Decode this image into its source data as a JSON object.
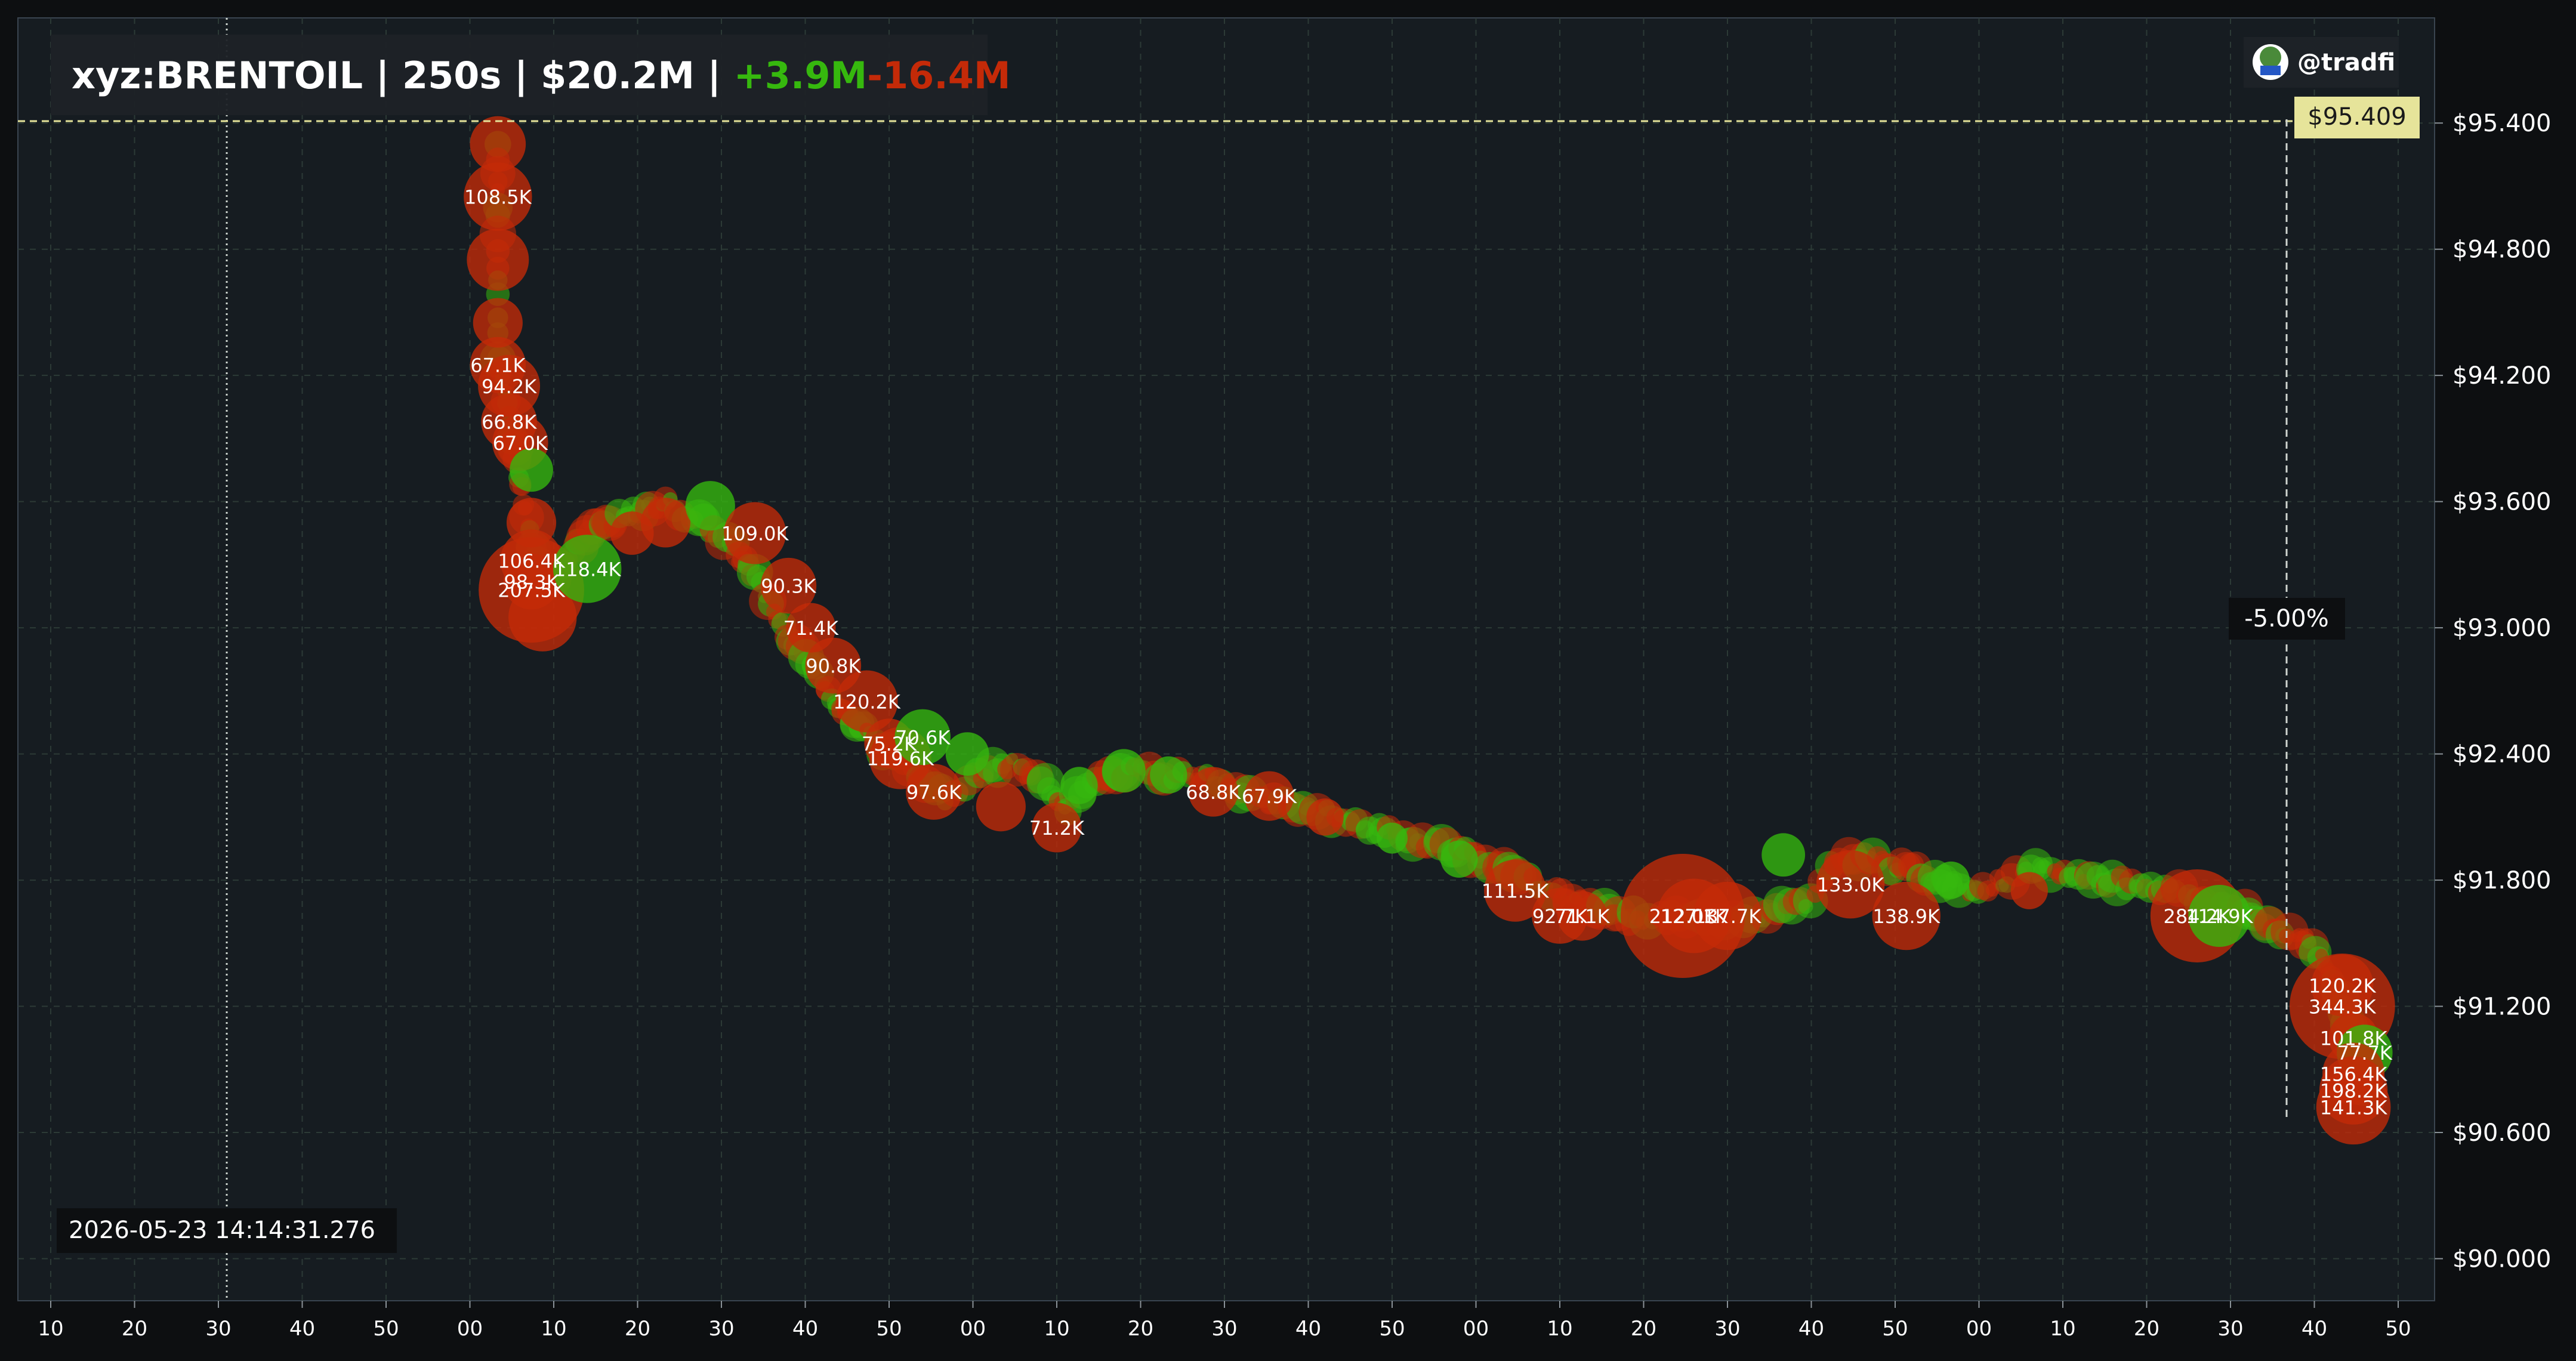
{
  "header": {
    "symbol": "xyz:BRENTOIL",
    "sep1": " | ",
    "window": "250s",
    "sep2": " | ",
    "volume": "$20.2M",
    "sep3": " | ",
    "buy": "+3.9M",
    "sell": "-16.4M"
  },
  "badge": {
    "handle": "@tradfi"
  },
  "timestamp": "2026-05-23 14:14:31.276",
  "current_price_label": "$95.409",
  "pct_change_label": "-5.00%",
  "colors": {
    "background": "#161c21",
    "buy": "#36b80e",
    "sell": "#c42a08",
    "price_line": "#e6e49a",
    "price_tag_bg": "#e6e49a",
    "grid": "#2c3a36"
  },
  "chart_data": {
    "type": "scatter",
    "title": "",
    "xlabel": "",
    "ylabel": "",
    "ylim": [
      89.8,
      95.9
    ],
    "x_tick_labels": [
      "10",
      "20",
      "30",
      "40",
      "50",
      "00",
      "10",
      "20",
      "30",
      "40",
      "50",
      "00",
      "10",
      "20",
      "30",
      "40",
      "50",
      "00",
      "10",
      "20",
      "30",
      "40",
      "50",
      "00",
      "10",
      "20",
      "30",
      "40",
      "50"
    ],
    "y_ticks": [
      90.0,
      90.6,
      91.2,
      91.8,
      92.4,
      93.0,
      93.6,
      94.2,
      94.8,
      95.4
    ],
    "y_tick_labels": [
      "$90.000",
      "$90.600",
      "$91.200",
      "$91.800",
      "$92.400",
      "$93.000",
      "$93.600",
      "$94.200",
      "$94.800",
      "$95.400"
    ],
    "current_price": 95.409,
    "grid": true,
    "series_colors": {
      "buy": "#36b80e",
      "sell": "#c42a08"
    },
    "path": [
      [
        40,
        95.3
      ],
      [
        40,
        94.9
      ],
      [
        40,
        94.3
      ],
      [
        41,
        94.0
      ],
      [
        42,
        93.7
      ],
      [
        43,
        93.4
      ],
      [
        44,
        93.2
      ],
      [
        46,
        93.3
      ],
      [
        48,
        93.45
      ],
      [
        50,
        93.5
      ],
      [
        53,
        93.55
      ],
      [
        55,
        93.6
      ],
      [
        58,
        93.5
      ],
      [
        61,
        93.4
      ],
      [
        63,
        93.25
      ],
      [
        65,
        93.05
      ],
      [
        67,
        92.9
      ],
      [
        69,
        92.75
      ],
      [
        71,
        92.6
      ],
      [
        73,
        92.5
      ],
      [
        75,
        92.4
      ],
      [
        78,
        92.3
      ],
      [
        80,
        92.2
      ],
      [
        83,
        92.3
      ],
      [
        86,
        92.35
      ],
      [
        89,
        92.25
      ],
      [
        91,
        92.15
      ],
      [
        94,
        92.28
      ],
      [
        97,
        92.32
      ],
      [
        100,
        92.3
      ],
      [
        103,
        92.3
      ],
      [
        106,
        92.22
      ],
      [
        109,
        92.18
      ],
      [
        112,
        92.15
      ],
      [
        115,
        92.1
      ],
      [
        118,
        92.05
      ],
      [
        121,
        92.0
      ],
      [
        124,
        91.98
      ],
      [
        127,
        91.92
      ],
      [
        130,
        91.85
      ],
      [
        133,
        91.78
      ],
      [
        136,
        91.7
      ],
      [
        139,
        91.65
      ],
      [
        142,
        91.62
      ],
      [
        145,
        91.62
      ],
      [
        148,
        91.62
      ],
      [
        151,
        91.62
      ],
      [
        154,
        91.65
      ],
      [
        157,
        91.7
      ],
      [
        160,
        91.9
      ],
      [
        163,
        91.9
      ],
      [
        166,
        91.85
      ],
      [
        169,
        91.8
      ],
      [
        172,
        91.75
      ],
      [
        175,
        91.8
      ],
      [
        178,
        91.85
      ],
      [
        181,
        91.82
      ],
      [
        184,
        91.8
      ],
      [
        187,
        91.78
      ],
      [
        190,
        91.75
      ],
      [
        193,
        91.7
      ],
      [
        196,
        91.65
      ],
      [
        198,
        91.6
      ],
      [
        200,
        91.55
      ],
      [
        202,
        91.5
      ],
      [
        204,
        91.35
      ],
      [
        205,
        91.2
      ],
      [
        206,
        91.0
      ],
      [
        207,
        90.8
      ]
    ],
    "points": [
      {
        "x": 40,
        "y": 95.3,
        "size": 18,
        "side": "sell"
      },
      {
        "x": 40,
        "y": 95.05,
        "size": 22,
        "side": "sell",
        "label": "108.5K"
      },
      {
        "x": 40,
        "y": 94.75,
        "size": 20,
        "side": "sell"
      },
      {
        "x": 40,
        "y": 94.45,
        "size": 16,
        "side": "sell"
      },
      {
        "x": 40,
        "y": 94.25,
        "size": 18,
        "side": "sell",
        "label": "67.1K"
      },
      {
        "x": 41,
        "y": 94.15,
        "size": 20,
        "side": "sell",
        "label": "94.2K"
      },
      {
        "x": 41,
        "y": 93.98,
        "size": 18,
        "side": "sell",
        "label": "66.8K"
      },
      {
        "x": 42,
        "y": 93.88,
        "size": 18,
        "side": "sell",
        "label": "67.0K"
      },
      {
        "x": 43,
        "y": 93.75,
        "size": 14,
        "side": "buy"
      },
      {
        "x": 43,
        "y": 93.5,
        "size": 16,
        "side": "sell"
      },
      {
        "x": 43,
        "y": 93.32,
        "size": 20,
        "side": "sell",
        "label": "106.4K"
      },
      {
        "x": 43,
        "y": 93.22,
        "size": 18,
        "side": "sell",
        "label": "98.3K"
      },
      {
        "x": 43,
        "y": 93.18,
        "size": 34,
        "side": "sell",
        "label": "207.5K"
      },
      {
        "x": 44,
        "y": 93.05,
        "size": 22,
        "side": "sell"
      },
      {
        "x": 48,
        "y": 93.28,
        "size": 22,
        "side": "buy",
        "label": "118.4K"
      },
      {
        "x": 52,
        "y": 93.45,
        "size": 14,
        "side": "sell"
      },
      {
        "x": 55,
        "y": 93.5,
        "size": 16,
        "side": "sell"
      },
      {
        "x": 59,
        "y": 93.58,
        "size": 16,
        "side": "buy"
      },
      {
        "x": 63,
        "y": 93.45,
        "size": 20,
        "side": "sell",
        "label": "109.0K"
      },
      {
        "x": 66,
        "y": 93.2,
        "size": 18,
        "side": "sell",
        "label": "90.3K"
      },
      {
        "x": 68,
        "y": 93.0,
        "size": 16,
        "side": "sell",
        "label": "71.4K"
      },
      {
        "x": 70,
        "y": 92.82,
        "size": 18,
        "side": "sell",
        "label": "90.8K"
      },
      {
        "x": 73,
        "y": 92.65,
        "size": 20,
        "side": "sell",
        "label": "120.2K"
      },
      {
        "x": 75,
        "y": 92.45,
        "size": 16,
        "side": "sell",
        "label": "75.2K"
      },
      {
        "x": 76,
        "y": 92.38,
        "size": 20,
        "side": "sell",
        "label": "119.6K"
      },
      {
        "x": 78,
        "y": 92.48,
        "size": 18,
        "side": "buy",
        "label": "70.6K"
      },
      {
        "x": 79,
        "y": 92.22,
        "size": 18,
        "side": "sell",
        "label": "97.6K"
      },
      {
        "x": 82,
        "y": 92.4,
        "size": 14,
        "side": "buy"
      },
      {
        "x": 85,
        "y": 92.15,
        "size": 16,
        "side": "sell"
      },
      {
        "x": 90,
        "y": 92.05,
        "size": 16,
        "side": "sell",
        "label": "71.2K"
      },
      {
        "x": 92,
        "y": 92.25,
        "size": 12,
        "side": "buy"
      },
      {
        "x": 96,
        "y": 92.32,
        "size": 14,
        "side": "buy"
      },
      {
        "x": 100,
        "y": 92.3,
        "size": 12,
        "side": "buy"
      },
      {
        "x": 104,
        "y": 92.22,
        "size": 16,
        "side": "sell",
        "label": "68.8K"
      },
      {
        "x": 109,
        "y": 92.2,
        "size": 16,
        "side": "sell",
        "label": "67.9K"
      },
      {
        "x": 114,
        "y": 92.1,
        "size": 12,
        "side": "sell"
      },
      {
        "x": 120,
        "y": 92.0,
        "size": 10,
        "side": "buy"
      },
      {
        "x": 126,
        "y": 91.9,
        "size": 12,
        "side": "buy"
      },
      {
        "x": 131,
        "y": 91.75,
        "size": 20,
        "side": "sell",
        "label": "111.5K"
      },
      {
        "x": 135,
        "y": 91.63,
        "size": 18,
        "side": "sell",
        "label": "92.7K"
      },
      {
        "x": 137,
        "y": 91.63,
        "size": 16,
        "side": "sell",
        "label": "71.1K"
      },
      {
        "x": 146,
        "y": 91.63,
        "size": 40,
        "side": "sell",
        "label": "212.0K"
      },
      {
        "x": 147,
        "y": 91.63,
        "size": 24,
        "side": "sell",
        "label": "127.1K"
      },
      {
        "x": 150,
        "y": 91.63,
        "size": 22,
        "side": "sell",
        "label": "137.7K"
      },
      {
        "x": 155,
        "y": 91.92,
        "size": 14,
        "side": "buy"
      },
      {
        "x": 161,
        "y": 91.78,
        "size": 22,
        "side": "sell",
        "label": "133.0K"
      },
      {
        "x": 166,
        "y": 91.63,
        "size": 22,
        "side": "sell",
        "label": "138.9K"
      },
      {
        "x": 170,
        "y": 91.8,
        "size": 12,
        "side": "buy"
      },
      {
        "x": 177,
        "y": 91.75,
        "size": 12,
        "side": "sell"
      },
      {
        "x": 192,
        "y": 91.63,
        "size": 30,
        "side": "sell",
        "label": "284.2K"
      },
      {
        "x": 194,
        "y": 91.63,
        "size": 20,
        "side": "buy",
        "label": "114.9K"
      },
      {
        "x": 205,
        "y": 91.3,
        "size": 20,
        "side": "sell",
        "label": "120.2K"
      },
      {
        "x": 205,
        "y": 91.2,
        "size": 34,
        "side": "sell",
        "label": "344.3K"
      },
      {
        "x": 206,
        "y": 91.05,
        "size": 16,
        "side": "sell",
        "label": "101.8K"
      },
      {
        "x": 207,
        "y": 90.98,
        "size": 18,
        "side": "buy",
        "label": "77.7K"
      },
      {
        "x": 206,
        "y": 90.88,
        "size": 20,
        "side": "sell",
        "label": "156.4K"
      },
      {
        "x": 206,
        "y": 90.8,
        "size": 22,
        "side": "sell",
        "label": "198.2K"
      },
      {
        "x": 206,
        "y": 90.72,
        "size": 24,
        "side": "sell",
        "label": "141.3K"
      }
    ]
  }
}
